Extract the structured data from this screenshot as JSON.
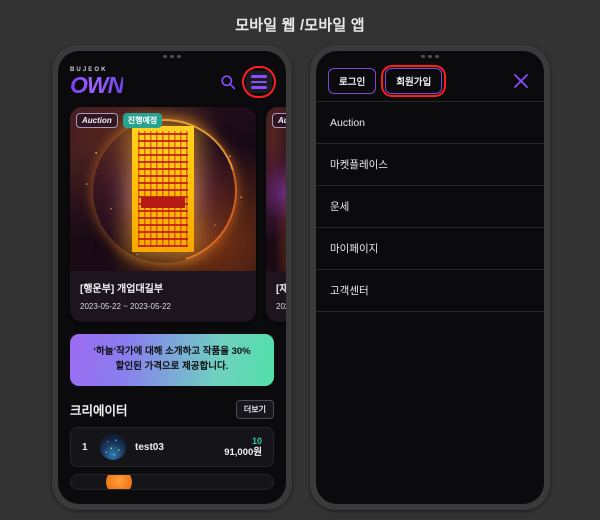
{
  "page": {
    "title": "모바일 웹 /모바일 앱"
  },
  "colors": {
    "background": "#333333",
    "phone_frame": "#3a3a3a",
    "screen": "#0b0b0d",
    "accent_purple": "#8b4dff",
    "highlight_red": "#ff1e1e",
    "badge_teal": "#29a391",
    "count_teal": "#35c7a8"
  },
  "mobile_web": {
    "header": {
      "logo_top": "BUJEOK",
      "logo_main": "OWN",
      "search_icon": "search-icon",
      "menu_icon": "hamburger-menu-icon"
    },
    "cards": [
      {
        "badge_type": "Auction",
        "badge_status": "진행예정",
        "title": "[행운부] 개업대길부",
        "date": "2023-05-22 ~ 2023-05-22"
      },
      {
        "badge_type": "Auction",
        "badge_status": "",
        "title": "[재",
        "date": "202"
      }
    ],
    "promo": {
      "line1": "‘하늘’작가에 대해 소개하고 작품을 30%",
      "line2": "할인된 가격으로 제공합니다."
    },
    "creator_section": {
      "title": "크리에이터",
      "more_label": "더보기",
      "rows": [
        {
          "rank": "1",
          "name": "test03",
          "count": "10",
          "price": "91,000원"
        }
      ]
    }
  },
  "mobile_app": {
    "header": {
      "login_label": "로그인",
      "signup_label": "회원가입",
      "close_icon": "close-x-icon"
    },
    "menu_items": [
      {
        "label": "Auction"
      },
      {
        "label": "마켓플레이스"
      },
      {
        "label": "운세"
      },
      {
        "label": "마이페이지"
      },
      {
        "label": "고객센터"
      }
    ]
  }
}
